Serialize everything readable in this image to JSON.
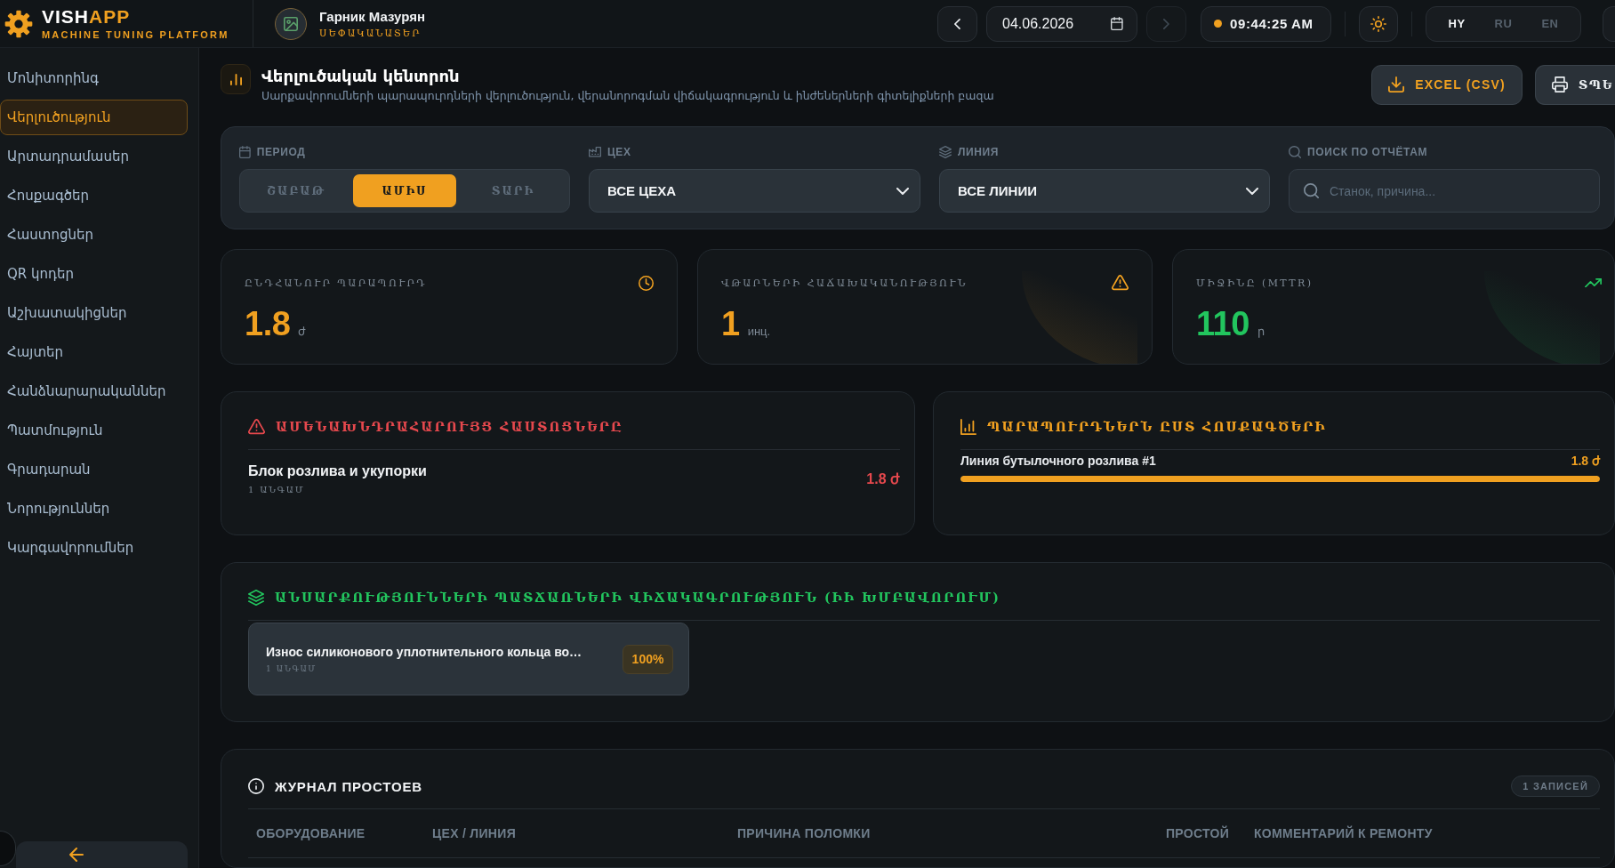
{
  "brand": {
    "name": "VISH",
    "accent": "APP",
    "tagline": "MACHINE TUNING PLATFORM"
  },
  "user": {
    "name": "Гарник Мазурян",
    "role": "ՍԵՓԱԿԱՆԱՏԵՐ"
  },
  "toolbar": {
    "prev": {
      "disabled": false
    },
    "date": "04.06.2026",
    "next": {
      "disabled": true
    },
    "time": "09:44:25 AM",
    "languages": [
      {
        "label": "HY",
        "selected": true
      },
      {
        "label": "RU",
        "selected": false
      },
      {
        "label": "EN",
        "selected": false
      }
    ]
  },
  "sidebar": {
    "items": [
      {
        "label": "Մոնիտորինգ",
        "selected": false
      },
      {
        "label": "Վերլուծություն",
        "selected": true
      },
      {
        "label": "Արտադրամասեր",
        "selected": false
      },
      {
        "label": "Հոսքագծեր",
        "selected": false
      },
      {
        "label": "Հաստոցներ",
        "selected": false
      },
      {
        "label": "QR կոդեր",
        "selected": false
      },
      {
        "label": "Աշխատակիցներ",
        "selected": false
      },
      {
        "label": "Հայտեր",
        "selected": false
      },
      {
        "label": "Հանձնարարականներ",
        "selected": false
      },
      {
        "label": "Պատմություն",
        "selected": false
      },
      {
        "label": "Գրադարան",
        "selected": false
      },
      {
        "label": "Նորություններ",
        "selected": false
      },
      {
        "label": "Կարգավորումներ",
        "selected": false
      }
    ]
  },
  "header": {
    "title": "Վերլուծական կենտրոն",
    "subtitle": "Սարքավորումների պարապուրդների վերլուծություն, վերանորոգման վիճակագրություն և ինժեներների գիտելիքների բազա",
    "actions": [
      {
        "kind": "download",
        "label": "EXCEL (CSV)"
      },
      {
        "kind": "print",
        "label": "ՏՊԵ"
      }
    ]
  },
  "filters": {
    "period": {
      "label": "ПЕРИОД",
      "options": [
        {
          "label": "ՇԱԲԱԹ",
          "selected": false
        },
        {
          "label": "ԱՄԻՍ",
          "selected": true
        },
        {
          "label": "ՏԱՐԻ",
          "selected": false
        }
      ]
    },
    "workshop": {
      "label": "ЦЕХ",
      "value": "ВСЕ ЦЕХА"
    },
    "line": {
      "label": "ЛИНИЯ",
      "value": "ВСЕ ЛИНИИ"
    },
    "search": {
      "label": "ПОИСК ПО ОТЧЁТАМ",
      "placeholder": "Станок, причина..."
    }
  },
  "kpis": [
    {
      "kind": "clock",
      "label": "ԸՆԴՀԱՆՈՒՐ ՊԱՐԱՊՈՒՐԴ",
      "value": "1.8",
      "unit": "ժ",
      "color": "#f0a020",
      "decor": false
    },
    {
      "kind": "warning",
      "label": "ՎԹԱՐՆԵՐԻ ՀԱՃԱԽԱԿԱՆՈՒԹՅՈՒՆ",
      "value": "1",
      "unit": "инц.",
      "color": "#f0a020",
      "decor": true
    },
    {
      "kind": "trend",
      "label": "ՄԻՋԻՆԸ (MTTR)",
      "value": "110",
      "unit": "ր",
      "color": "#22c55e",
      "decor": true
    }
  ],
  "top_machines": {
    "title": "ԱՄԵՆԱԽՆԴՐԱՀԱՐՈՒՅՑ ՀԱՍՏՈՑՆԵՐԸ",
    "items": [
      {
        "name": "Блок розлива и укупорки",
        "count": "1 ԱՆԳԱՄ",
        "value": "1.8 ժ"
      }
    ]
  },
  "lines": {
    "title": "ՊԱՐԱՊՈՒՐԴՆԵՐՆ ԸՍՏ ՀՈՍՔԱԳԾԵՐԻ",
    "items": [
      {
        "name": "Линия бутылочного розлива #1",
        "value": "1.8 ժ",
        "level": 1
      }
    ]
  },
  "patterns": {
    "title": "ԱՆՍԱՐՔՈՒԹՅՈՒՆՆԵՐԻ ՊԱՏՃԱՌՆԵՐԻ ՎԻՃԱԿԱԳՐՈՒԹՅՈՒՆ (ԻԻ ԽՄԲԱՎՈՐՈՒՄ)",
    "items": [
      {
        "text": "Износ силиконового уплотнительного кольца во…",
        "count": "1 ԱՆԳԱՄ",
        "share": "100%"
      }
    ]
  },
  "journal": {
    "title": "ЖУРНАЛ ПРОСТОЕВ",
    "badge": "1 ЗАПИСЕЙ",
    "columns": [
      "ОБОРУДОВАНИЕ",
      "ЦЕХ / ЛИНИЯ",
      "ПРИЧИНА ПОЛОМКИ",
      "ПРОСТОЙ",
      "КОММЕНТАРИЙ К РЕМОНТУ"
    ]
  }
}
